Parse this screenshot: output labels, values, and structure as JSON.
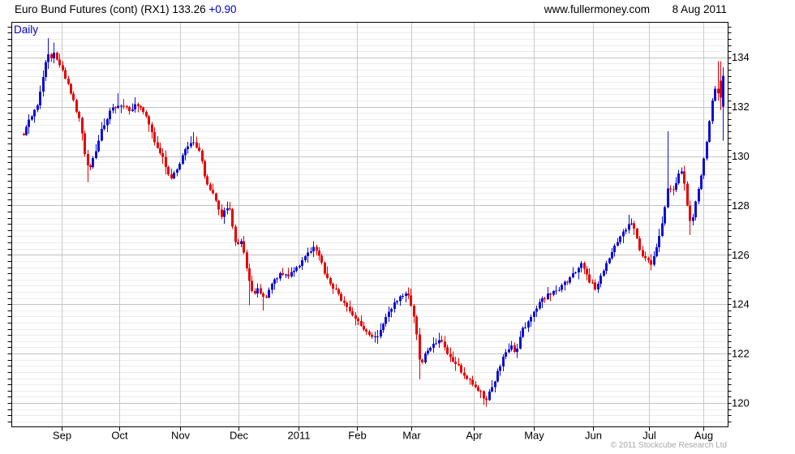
{
  "header": {
    "title": "Euro Bund Futures (cont) (RX1) 133.26",
    "change": "+0.90",
    "site": "www.fullermoney.com",
    "date": "8 Aug 2011"
  },
  "chart": {
    "mode_label": "Daily",
    "copyright": "© 2011 Stockcube Research Ltd",
    "colors": {
      "up": "#0f0fd6",
      "down": "#e80000",
      "grid_minor": "#ececec",
      "grid_major": "#c2c2c2",
      "grid_vertical": "#c9c9c9",
      "frame": "#000000",
      "tick": "#000000",
      "label": "#000000",
      "accent_blue": "#0000cc",
      "copyright_gray": "#a6a6a6"
    }
  },
  "chart_data": {
    "type": "candlestick",
    "title": "Euro Bund Futures (cont) (RX1)",
    "period": "Daily",
    "as_of_date": "8 Aug 2011",
    "last_close": 133.26,
    "net_change": 0.9,
    "ylim": [
      119.03,
      135.42
    ],
    "y_ticks": [
      120,
      122,
      124,
      126,
      128,
      130,
      132,
      134
    ],
    "y_minor_step": 0.25,
    "grid": true,
    "x_ticks": [
      {
        "label": "Sep",
        "t": 0.0702
      },
      {
        "label": "Oct",
        "t": 0.1506
      },
      {
        "label": "Nov",
        "t": 0.235
      },
      {
        "label": "Dec",
        "t": 0.3171
      },
      {
        "label": "2011",
        "t": 0.4009
      },
      {
        "label": "Feb",
        "t": 0.4824
      },
      {
        "label": "Mar",
        "t": 0.5583
      },
      {
        "label": "Apr",
        "t": 0.6444
      },
      {
        "label": "May",
        "t": 0.7293
      },
      {
        "label": "Jun",
        "t": 0.8109
      },
      {
        "label": "Jul",
        "t": 0.8901
      },
      {
        "label": "Aug",
        "t": 0.966
      }
    ],
    "candle_count": 252,
    "seed": 11,
    "close_noise": 0.09,
    "wick_noise": 0.26,
    "price_path": [
      [
        0.0159,
        130.9
      ],
      [
        0.0249,
        131.5
      ],
      [
        0.0362,
        132.1
      ],
      [
        0.0453,
        133.6
      ],
      [
        0.0498,
        134.3
      ],
      [
        0.0544,
        133.9
      ],
      [
        0.0589,
        134.15
      ],
      [
        0.0634,
        133.8
      ],
      [
        0.0747,
        133.2
      ],
      [
        0.0883,
        132.0
      ],
      [
        0.0951,
        131.4
      ],
      [
        0.1019,
        130.1
      ],
      [
        0.1064,
        129.4
      ],
      [
        0.1132,
        129.9
      ],
      [
        0.1246,
        131.0
      ],
      [
        0.137,
        131.8
      ],
      [
        0.1495,
        132.1
      ],
      [
        0.1631,
        131.85
      ],
      [
        0.1721,
        132.1
      ],
      [
        0.1823,
        131.8
      ],
      [
        0.1914,
        131.3
      ],
      [
        0.2016,
        130.4
      ],
      [
        0.2106,
        129.9
      ],
      [
        0.222,
        129.0
      ],
      [
        0.2333,
        129.7
      ],
      [
        0.2435,
        130.3
      ],
      [
        0.2537,
        130.6
      ],
      [
        0.2627,
        130.1
      ],
      [
        0.2707,
        129.0
      ],
      [
        0.2808,
        128.4
      ],
      [
        0.2922,
        127.6
      ],
      [
        0.3024,
        128.0
      ],
      [
        0.3125,
        126.5
      ],
      [
        0.3216,
        126.55
      ],
      [
        0.3295,
        125.0
      ],
      [
        0.3363,
        124.45
      ],
      [
        0.3442,
        124.65
      ],
      [
        0.3522,
        124.2
      ],
      [
        0.3612,
        124.8
      ],
      [
        0.3748,
        125.25
      ],
      [
        0.3884,
        125.2
      ],
      [
        0.4031,
        125.65
      ],
      [
        0.4201,
        126.3
      ],
      [
        0.4269,
        126.2
      ],
      [
        0.4371,
        125.1
      ],
      [
        0.4496,
        124.65
      ],
      [
        0.4632,
        124.05
      ],
      [
        0.4767,
        123.5
      ],
      [
        0.4903,
        122.95
      ],
      [
        0.5028,
        122.6
      ],
      [
        0.5119,
        122.8
      ],
      [
        0.5277,
        123.8
      ],
      [
        0.5413,
        124.35
      ],
      [
        0.5526,
        124.4
      ],
      [
        0.5594,
        123.8
      ],
      [
        0.5651,
        122.75
      ],
      [
        0.5696,
        121.5
      ],
      [
        0.5753,
        121.9
      ],
      [
        0.5877,
        122.3
      ],
      [
        0.5979,
        122.5
      ],
      [
        0.6104,
        121.95
      ],
      [
        0.6217,
        121.5
      ],
      [
        0.6376,
        120.95
      ],
      [
        0.6523,
        120.5
      ],
      [
        0.6614,
        120.15
      ],
      [
        0.6716,
        120.7
      ],
      [
        0.6795,
        121.4
      ],
      [
        0.6874,
        121.9
      ],
      [
        0.6953,
        122.35
      ],
      [
        0.7033,
        122.0
      ],
      [
        0.7101,
        122.85
      ],
      [
        0.7225,
        123.35
      ],
      [
        0.735,
        124.0
      ],
      [
        0.7474,
        124.4
      ],
      [
        0.7599,
        124.5
      ],
      [
        0.7735,
        124.9
      ],
      [
        0.7848,
        125.3
      ],
      [
        0.795,
        125.65
      ],
      [
        0.8052,
        125.0
      ],
      [
        0.8154,
        124.6
      ],
      [
        0.8244,
        125.3
      ],
      [
        0.838,
        126.2
      ],
      [
        0.8493,
        126.7
      ],
      [
        0.8618,
        127.35
      ],
      [
        0.8675,
        127.1
      ],
      [
        0.8754,
        126.3
      ],
      [
        0.8844,
        125.8
      ],
      [
        0.8924,
        125.6
      ],
      [
        0.9003,
        126.4
      ],
      [
        0.9082,
        127.4
      ],
      [
        0.9162,
        128.9
      ],
      [
        0.9218,
        128.5
      ],
      [
        0.9275,
        128.85
      ],
      [
        0.9332,
        129.5
      ],
      [
        0.9377,
        129.2
      ],
      [
        0.9422,
        128.1
      ],
      [
        0.9479,
        127.1
      ],
      [
        0.9524,
        127.9
      ],
      [
        0.9581,
        128.6
      ],
      [
        0.9626,
        129.3
      ],
      [
        0.9683,
        130.2
      ],
      [
        0.9728,
        131.2
      ],
      [
        0.9773,
        132.2
      ],
      [
        0.9818,
        132.8
      ],
      [
        0.9864,
        132.4
      ],
      [
        0.9898,
        131.9
      ],
      [
        0.9932,
        133.26
      ]
    ],
    "spikes": [
      {
        "t": 0.0498,
        "high": 134.78
      },
      {
        "t": 0.0589,
        "high": 134.6
      },
      {
        "t": 0.1064,
        "low": 128.95
      },
      {
        "t": 0.1495,
        "high": 132.55
      },
      {
        "t": 0.2537,
        "high": 130.97
      },
      {
        "t": 0.3295,
        "low": 123.95
      },
      {
        "t": 0.3522,
        "low": 123.75
      },
      {
        "t": 0.4201,
        "high": 126.5
      },
      {
        "t": 0.5526,
        "high": 124.68
      },
      {
        "t": 0.5696,
        "low": 120.95
      },
      {
        "t": 0.6614,
        "low": 119.85
      },
      {
        "t": 0.8618,
        "high": 127.62
      },
      {
        "t": 0.9162,
        "high": 131.0
      },
      {
        "t": 0.9479,
        "low": 126.8
      },
      {
        "t": 0.9864,
        "high": 133.85
      }
    ],
    "final_candles": [
      {
        "from_end": 1,
        "open": 133.05,
        "close": 132.36,
        "high": 133.85,
        "low": 131.85
      },
      {
        "from_end": 0,
        "open": 132.0,
        "close": 133.26,
        "high": 133.6,
        "low": 130.62
      }
    ]
  }
}
